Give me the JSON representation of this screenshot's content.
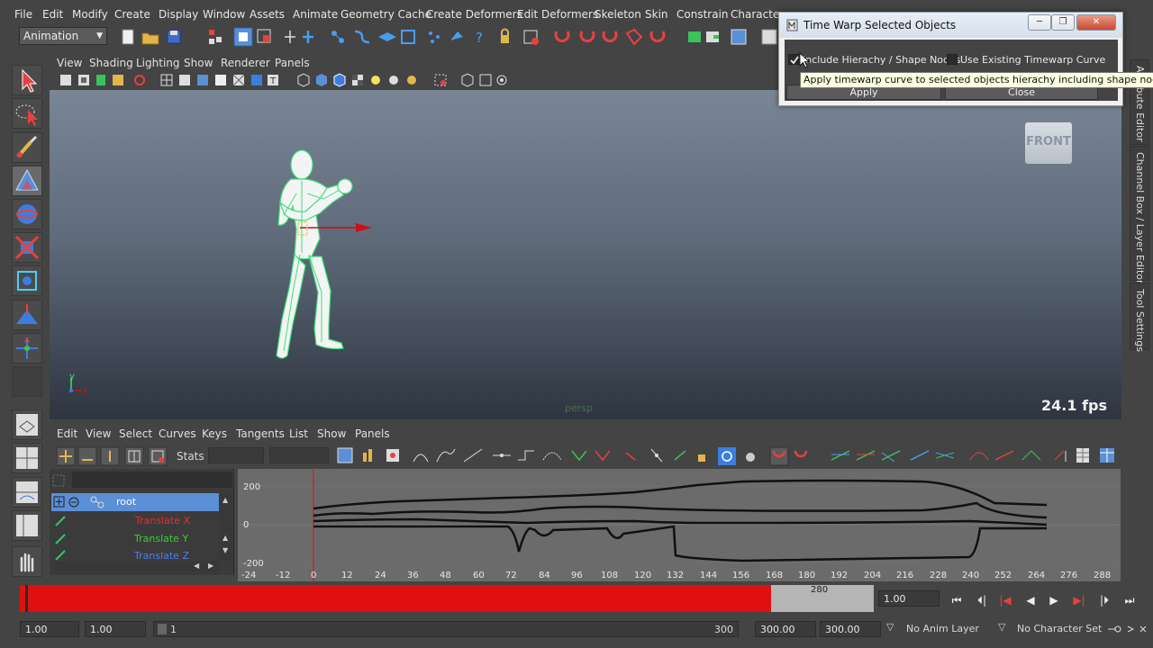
{
  "menubar": {
    "items": [
      "File",
      "Edit",
      "Modify",
      "Create",
      "Display",
      "Window",
      "Assets",
      "Animate",
      "Geometry Cache",
      "Create Deformers",
      "Edit Deformers",
      "Skeleton",
      "Skin",
      "Constrain",
      "Character"
    ]
  },
  "statusline": {
    "mode": "Animation"
  },
  "viewport": {
    "menu": [
      "View",
      "Shading",
      "Lighting",
      "Show",
      "Renderer",
      "Panels"
    ],
    "camera_label": "persp",
    "view_cube_label": "FRONT",
    "fps": "24.1 fps",
    "axis_y": "y",
    "axis_x": "x"
  },
  "side_tabs": [
    "Attribute Editor",
    "Channel Box / Layer Editor",
    "Tool Settings"
  ],
  "graph_editor": {
    "menu": [
      "Edit",
      "View",
      "Select",
      "Curves",
      "Keys",
      "Tangents",
      "List",
      "Show",
      "Panels"
    ],
    "stats_label": "Stats",
    "outliner": {
      "root": "root",
      "channels": [
        {
          "label": "Translate X",
          "color": "#e53030"
        },
        {
          "label": "Translate Y",
          "color": "#35d035"
        },
        {
          "label": "Translate Z",
          "color": "#4a7ff0"
        }
      ]
    },
    "y_ticks": [
      "200",
      "0",
      "-200"
    ],
    "x_ticks": [
      "-24",
      "-12",
      "0",
      "12",
      "24",
      "36",
      "48",
      "60",
      "72",
      "84",
      "96",
      "108",
      "120",
      "132",
      "144",
      "156",
      "168",
      "180",
      "192",
      "204",
      "216",
      "228",
      "240",
      "252",
      "264",
      "276",
      "288"
    ]
  },
  "timeslider": {
    "current_frame": "1.00",
    "end_label": "280",
    "progress": 0.88
  },
  "range": {
    "start": "1.00",
    "playback_start": "1.00",
    "slider_start": "1",
    "slider_end": "300",
    "playback_end": "300.00",
    "end": "300.00",
    "anim_layer": "No Anim Layer",
    "character_set": "No Character Set"
  },
  "dialog": {
    "title": "Time Warp Selected Objects",
    "checkbox1_label": "Include Hierachy / Shape Nodes",
    "checkbox1_checked": true,
    "checkbox2_label": "Use Existing Timewarp Curve",
    "checkbox2_checked": false,
    "apply_label": "Apply",
    "close_label": "Close",
    "tooltip": "Apply timewarp curve to selected objects hierachy including shape nodes"
  },
  "colors": {
    "timeslider_red": "#e01010",
    "selection_blue": "#5b8fd6",
    "wire_green": "#39e27a"
  }
}
